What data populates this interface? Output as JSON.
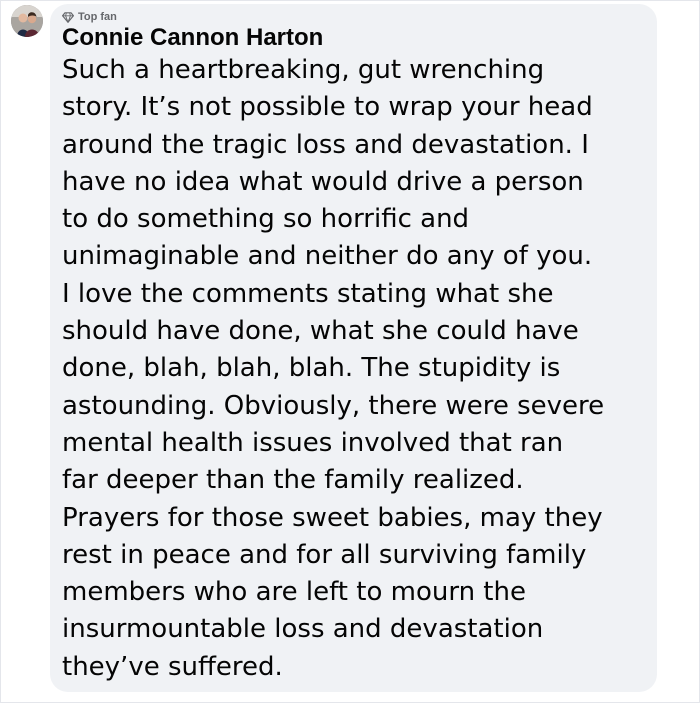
{
  "comment": {
    "badge_label": "Top fan",
    "badge_icon": "diamond-icon",
    "author": "Connie Cannon Harton",
    "lines": [
      "Such a heartbreaking, gut wrenching",
      "story. It’s not possible to wrap your head",
      "around the tragic loss and devastation. I",
      "have no idea what would drive a person",
      "to do something so horrific and",
      "unimaginable and neither do any of you.",
      "I love the comments stating what she",
      "should have done, what she could have",
      "done, blah, blah, blah. The stupidity is",
      "astounding. Obviously, there were severe",
      "mental health issues involved that ran",
      "far deeper than the family realized.",
      "Prayers for those sweet babies, may they",
      "rest in peace and for all surviving family",
      "members who are left to mourn the",
      "insurmountable loss and devastation",
      "they’ve suffered."
    ]
  },
  "colors": {
    "bubble_background": "#f0f2f5",
    "text": "#050505",
    "secondary_text": "#65676b"
  }
}
